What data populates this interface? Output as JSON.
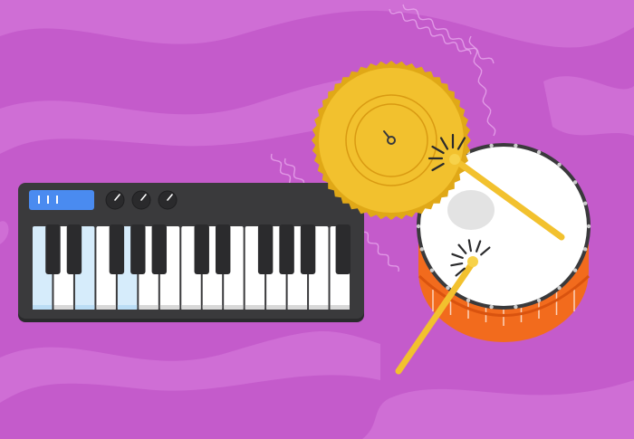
{
  "scene": {
    "description_free": true,
    "colors": {
      "background": "#C45BCB",
      "background_wave": "#CF6ED5",
      "keyboard_body": "#3A3A3C",
      "keyboard_body_dark": "#2A2A2C",
      "display": "#4A8BF0",
      "display_marks": "#FFFFFF",
      "white_key": "#FFFFFF",
      "white_key_pressed": "#D6ECFB",
      "black_key": "#2B2B2D",
      "knob": "#2A2A2C",
      "cymbal": "#F2C12E",
      "cymbal_edge": "#E0A817",
      "cymbal_ring": "#D99A12",
      "drum_head": "#FFFFFF",
      "drum_shell": "#F26B1D",
      "drum_shell_dark": "#D9530F",
      "drum_rim": "#3A3A3C",
      "stick": "#F2C12E",
      "stick_tip": "#F7D24A",
      "vibration": "#E8A9EC"
    }
  },
  "keyboard": {
    "display_marks": 3,
    "knobs": 3,
    "white_keys": 15,
    "pressed_white_keys": [
      0,
      2,
      4
    ]
  },
  "cymbal": {
    "icon": "cymbal-icon"
  },
  "drum": {
    "icon": "snare-drum-icon"
  },
  "sticks": {
    "count": 2
  }
}
